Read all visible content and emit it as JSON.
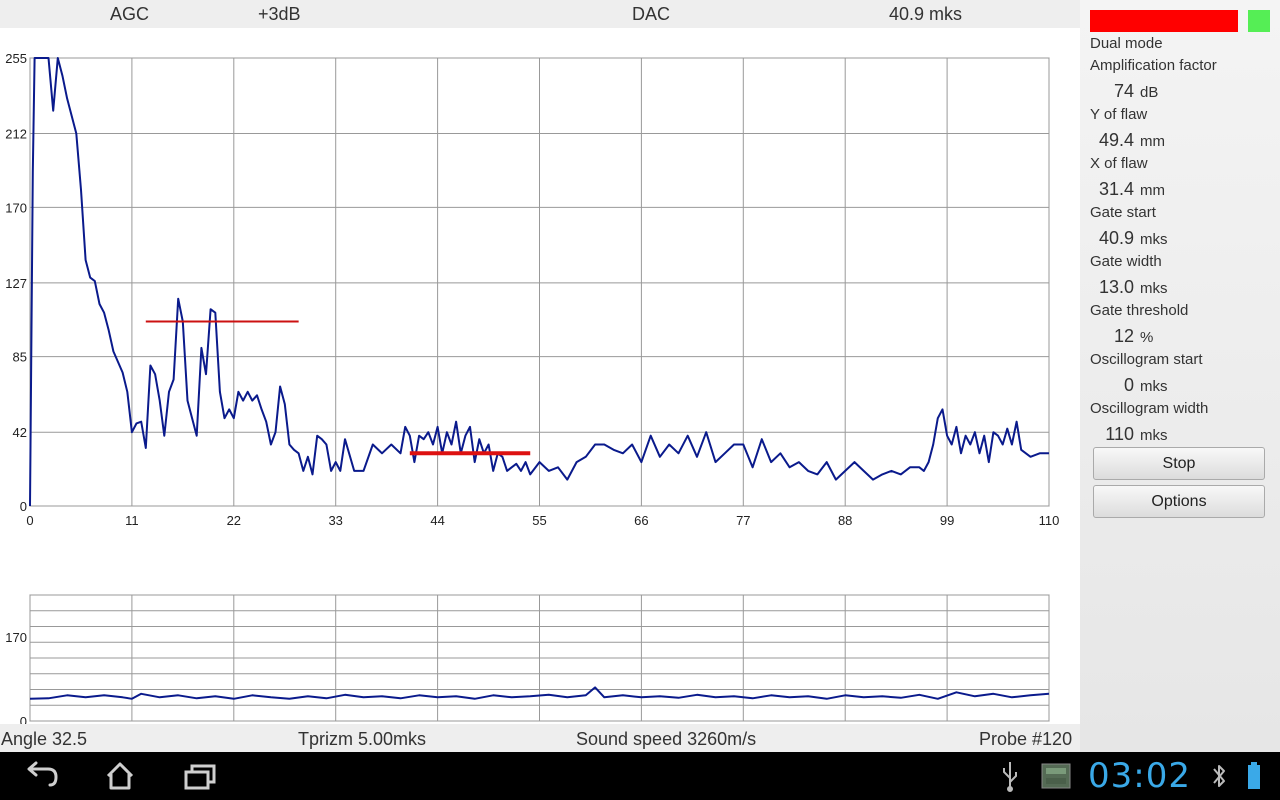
{
  "header": {
    "agc": "AGC",
    "gain": "+3dB",
    "dac": "DAC",
    "gate_time": "40.9 mks"
  },
  "footer": {
    "angle": "Angle 32.5",
    "tprizm": "Tprizm 5.00mks",
    "sound_speed": "Sound speed 3260m/s",
    "probe": "Probe #120"
  },
  "panel": {
    "indicator_colors": [
      "#ff0000",
      "#55ee55"
    ],
    "mode": "Dual mode",
    "params": [
      {
        "label": "Amplification factor",
        "value": "74",
        "unit": "dB"
      },
      {
        "label": "Y of flaw",
        "value": "49.4",
        "unit": "mm"
      },
      {
        "label": "X of flaw",
        "value": "31.4",
        "unit": "mm"
      },
      {
        "label": "Gate start",
        "value": "40.9",
        "unit": "mks"
      },
      {
        "label": "Gate width",
        "value": "13.0",
        "unit": "mks"
      },
      {
        "label": "Gate threshold",
        "value": "12",
        "unit": "%"
      },
      {
        "label": "Oscillogram start",
        "value": "0",
        "unit": "mks"
      },
      {
        "label": "Oscillogram width",
        "value": "110",
        "unit": "mks"
      }
    ],
    "stop_label": "Stop",
    "options_label": "Options"
  },
  "navbar": {
    "icons": [
      "back-icon",
      "home-icon",
      "recent-apps-icon",
      "usb-icon",
      "gallery-icon",
      "bluetooth-icon",
      "battery-icon"
    ],
    "clock": "03:02",
    "clock_color": "#3aa9e8"
  },
  "chart_data": [
    {
      "type": "line",
      "x_ticks": [
        0,
        11,
        22,
        33,
        44,
        55,
        66,
        77,
        88,
        99,
        110
      ],
      "y_ticks": [
        0,
        42,
        85,
        127,
        170,
        212,
        255
      ],
      "xlim": [
        0,
        110
      ],
      "ylim": [
        0,
        255
      ],
      "grid": true,
      "line_color": "#0a1a8c",
      "series": [
        {
          "x": [
            0,
            0.3,
            0.5,
            1,
            2,
            2.5,
            3,
            3.5,
            4,
            5,
            5.5,
            6,
            6.5,
            7,
            7.5,
            8,
            8.5,
            9,
            10,
            10.5,
            11,
            11.5,
            12,
            12.5,
            13,
            13.5,
            14,
            14.5,
            15,
            15.5,
            16,
            16.5,
            17,
            17.5,
            18,
            18.5,
            19,
            19.5,
            20,
            20.5,
            21,
            21.5,
            22,
            22.5,
            23,
            23.5,
            24,
            24.5,
            25,
            25.5,
            26,
            26.5,
            27,
            27.5,
            28,
            28.5,
            29,
            29.5,
            30,
            30.5,
            31,
            31.5,
            32,
            32.5,
            33,
            33.5,
            34,
            35,
            36,
            37,
            38,
            39,
            40,
            40.5,
            41,
            41.5,
            42,
            42.5,
            43,
            43.5,
            44,
            44.5,
            45,
            45.5,
            46,
            46.5,
            47,
            47.5,
            48,
            48.5,
            49,
            49.5,
            50,
            50.5,
            51,
            51.5,
            52,
            52.5,
            53,
            53.5,
            54,
            55,
            56,
            57,
            58,
            59,
            60,
            61,
            62,
            63,
            64,
            65,
            66,
            67,
            68,
            69,
            70,
            71,
            72,
            73,
            74,
            75,
            76,
            77,
            78,
            79,
            80,
            81,
            82,
            83,
            84,
            85,
            86,
            87,
            88,
            89,
            90,
            91,
            92,
            93,
            94,
            95,
            96,
            96.5,
            97,
            97.5,
            98,
            98.5,
            99,
            99.5,
            100,
            100.5,
            101,
            101.5,
            102,
            102.5,
            103,
            103.5,
            104,
            104.5,
            105,
            105.5,
            106,
            106.5,
            107,
            108,
            109,
            110
          ],
          "values": [
            0,
            190,
            255,
            255,
            255,
            225,
            255,
            245,
            232,
            212,
            180,
            140,
            130,
            128,
            115,
            110,
            100,
            88,
            76,
            65,
            42,
            47,
            48,
            33,
            80,
            75,
            60,
            40,
            65,
            72,
            118,
            105,
            60,
            50,
            40,
            90,
            75,
            112,
            110,
            65,
            50,
            55,
            50,
            65,
            60,
            65,
            60,
            63,
            55,
            48,
            35,
            42,
            68,
            58,
            35,
            32,
            30,
            20,
            28,
            18,
            40,
            38,
            35,
            20,
            25,
            20,
            38,
            20,
            20,
            35,
            30,
            35,
            30,
            45,
            40,
            25,
            40,
            38,
            42,
            35,
            45,
            30,
            42,
            35,
            48,
            30,
            40,
            45,
            25,
            38,
            30,
            35,
            20,
            30,
            28,
            20,
            22,
            24,
            20,
            25,
            18,
            25,
            20,
            22,
            15,
            25,
            28,
            35,
            35,
            32,
            30,
            35,
            25,
            40,
            28,
            35,
            30,
            40,
            28,
            42,
            25,
            30,
            35,
            35,
            22,
            38,
            25,
            30,
            22,
            25,
            20,
            18,
            25,
            15,
            20,
            25,
            20,
            15,
            18,
            20,
            18,
            22,
            22,
            20,
            25,
            35,
            50,
            55,
            40,
            35,
            45,
            30,
            40,
            35,
            42,
            30,
            40,
            25,
            42,
            40,
            35,
            44,
            35,
            48,
            32,
            28,
            30,
            30
          ]
        }
      ],
      "markers": [
        {
          "name": "DAC level",
          "x": [
            12.5,
            29
          ],
          "y": [
            105,
            105
          ],
          "color": "#cc1111"
        },
        {
          "name": "Gate",
          "x": [
            41,
            54
          ],
          "y": [
            30,
            30
          ],
          "color": "#dd1111"
        }
      ]
    },
    {
      "type": "line",
      "x_ticks": [
        0,
        11,
        22,
        33,
        44,
        55,
        66,
        77,
        88,
        99,
        110
      ],
      "y_ticks": [
        0,
        170
      ],
      "xlim": [
        0,
        110
      ],
      "ylim": [
        0,
        255
      ],
      "grid": true,
      "line_color": "#0a1a8c",
      "series": [
        {
          "x": [
            0,
            2,
            4,
            6,
            8,
            10,
            11,
            12,
            14,
            16,
            18,
            20,
            22,
            24,
            26,
            28,
            30,
            32,
            34,
            36,
            38,
            40,
            42,
            44,
            46,
            48,
            50,
            52,
            54,
            56,
            58,
            60,
            61,
            62,
            64,
            66,
            68,
            70,
            72,
            74,
            76,
            78,
            80,
            82,
            84,
            86,
            88,
            90,
            92,
            94,
            96,
            98,
            100,
            102,
            104,
            106,
            108,
            110
          ],
          "values": [
            45,
            46,
            52,
            48,
            52,
            48,
            45,
            55,
            48,
            52,
            46,
            50,
            45,
            52,
            48,
            45,
            50,
            46,
            53,
            48,
            50,
            46,
            52,
            48,
            50,
            45,
            52,
            48,
            50,
            53,
            48,
            52,
            68,
            48,
            52,
            48,
            50,
            47,
            53,
            48,
            50,
            46,
            52,
            48,
            50,
            45,
            52,
            48,
            50,
            47,
            53,
            45,
            58,
            50,
            55,
            48,
            52,
            55
          ]
        }
      ]
    }
  ]
}
